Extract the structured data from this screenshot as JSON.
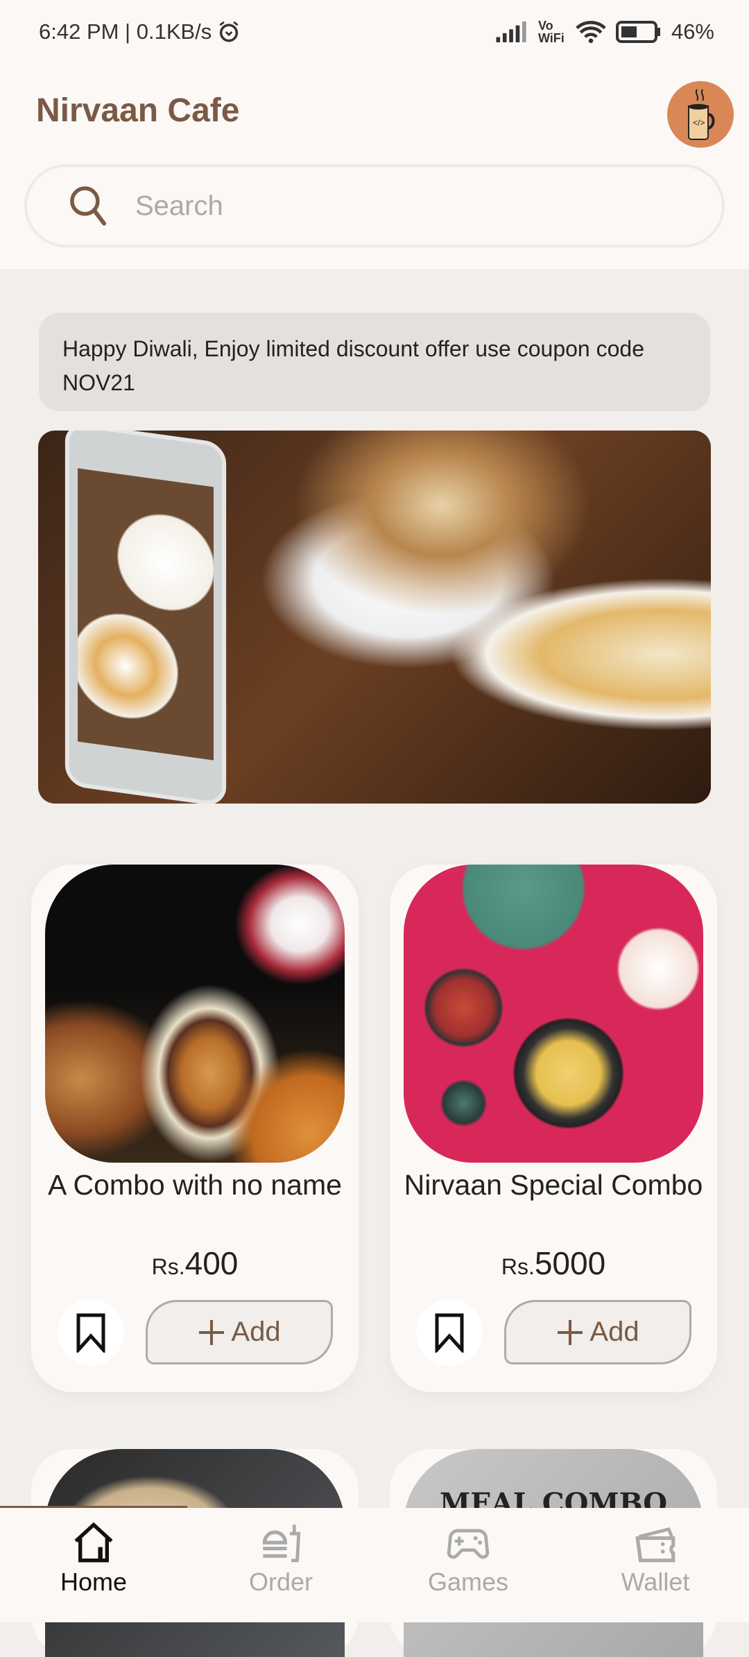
{
  "status_bar": {
    "time": "6:42 PM | 0.1KB/s",
    "network": "Vo WiFi",
    "battery": "46%"
  },
  "header": {
    "title": "Nirvaan Cafe",
    "avatar_icon": "coffee-cup-icon"
  },
  "search": {
    "placeholder": "Search"
  },
  "promo": {
    "text": "Happy Diwali, Enjoy limited discount offer use coupon code NOV21"
  },
  "products": [
    {
      "name": "A Combo with no name",
      "currency": "Rs.",
      "price": "400",
      "add_label": "Add"
    },
    {
      "name": "Nirvaan Special Combo",
      "currency": "Rs.",
      "price": "5000",
      "add_label": "Add"
    }
  ],
  "partial_products": [
    {
      "image_text": ""
    },
    {
      "image_text": "MEAL COMBO"
    }
  ],
  "nav": {
    "items": [
      {
        "label": "Home",
        "active": true
      },
      {
        "label": "Order"
      },
      {
        "label": "Games"
      },
      {
        "label": "Wallet"
      }
    ]
  },
  "colors": {
    "brand": "#7a5a45",
    "avatar": "#d98757",
    "background": "#f1eeeb"
  }
}
